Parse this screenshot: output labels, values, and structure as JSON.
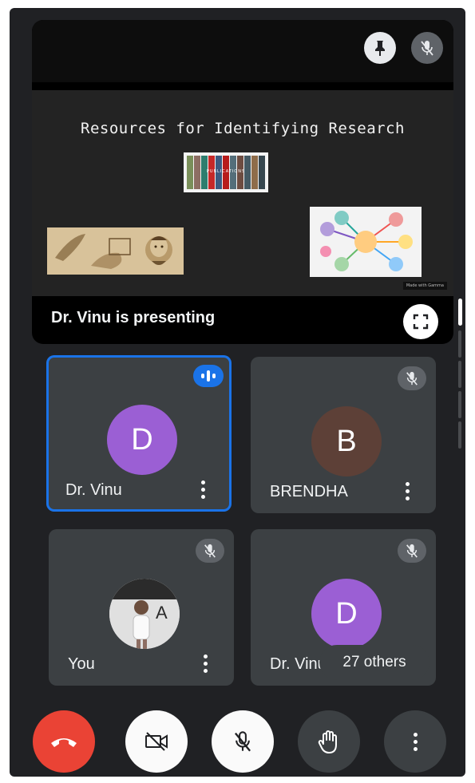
{
  "slide": {
    "title": "Resources for Identifying Research",
    "books_label": "PUBLICATIONS",
    "watermark": "Made with Gamma"
  },
  "presenting_text": "Dr. Vinu is presenting",
  "participants": [
    {
      "name": "Dr. Vinu",
      "initial": "D",
      "avatar_color": "#9b5fd4",
      "state": "speaking"
    },
    {
      "name": "BRENDHA",
      "initial": "B",
      "avatar_color": "#5d4037",
      "state": "muted"
    },
    {
      "name": "You",
      "initial": "",
      "avatar_color": "#cfcfcf",
      "state": "muted"
    },
    {
      "name": "Dr. Vinu",
      "initial": "D",
      "avatar_color": "#9b5fd4",
      "state": "muted"
    }
  ],
  "others_label": "27 others",
  "icons": {
    "pin": "pin-icon",
    "mic_off": "mic-off-icon",
    "fullscreen": "fullscreen-icon",
    "end_call": "end-call-icon",
    "camera_off": "camera-off-icon",
    "raise_hand": "hand-icon",
    "more": "more-options-icon"
  },
  "colors": {
    "end_call": "#ea4335",
    "active_border": "#1a73e8",
    "speaking_badge": "#1a73e8"
  }
}
